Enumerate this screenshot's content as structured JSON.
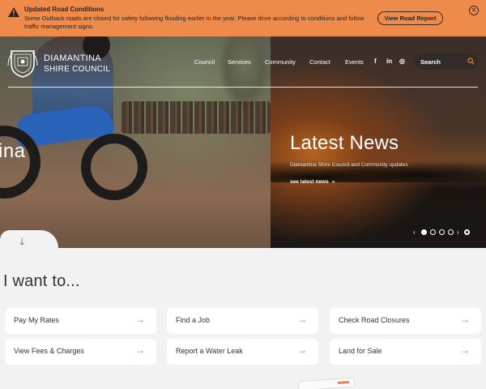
{
  "alert": {
    "title": "Updated Road Conditions",
    "message": "Some Outback roads are closed for safety following flooding earlier in the year. Please drive according to conditions and follow traffic management signs.",
    "button_label": "View Road Report",
    "close_icon": "close-icon",
    "warning_icon": "warning-icon"
  },
  "brand": {
    "line1": "DIAMANTINA",
    "line2": "SHIRE COUNCIL",
    "logo_icon": "council-crest-logo"
  },
  "nav": {
    "items": [
      "Council",
      "Services",
      "Community",
      "Contact",
      "Events"
    ],
    "social": [
      "f",
      "in",
      "◎"
    ],
    "social_icons": [
      "facebook-icon",
      "linkedin-icon",
      "instagram-icon"
    ]
  },
  "search": {
    "placeholder": "Search",
    "icon": "search-icon",
    "accent": "#e2733a"
  },
  "hero": {
    "left_text": "ina",
    "news_title": "Latest News",
    "news_subtitle": "Diamantina Shire Council and Community updates",
    "news_link": "see latest news",
    "news_link_chevron": "»",
    "carousel": {
      "prev": "‹",
      "next": "›",
      "dots": 5,
      "active_index": 0
    }
  },
  "iwant": {
    "heading": "I want to...",
    "cards": [
      {
        "label": "Pay My Rates"
      },
      {
        "label": "Find a Job"
      },
      {
        "label": "Check Road Closures"
      },
      {
        "label": "View Fees & Charges"
      },
      {
        "label": "Report a Water Leak"
      },
      {
        "label": "Land for Sale"
      }
    ],
    "arrow": "→"
  },
  "colors": {
    "alert_bg": "#ee8a4a",
    "accent": "#e2733a",
    "page_bg": "#f2f2f2",
    "card_bg": "#ffffff"
  }
}
